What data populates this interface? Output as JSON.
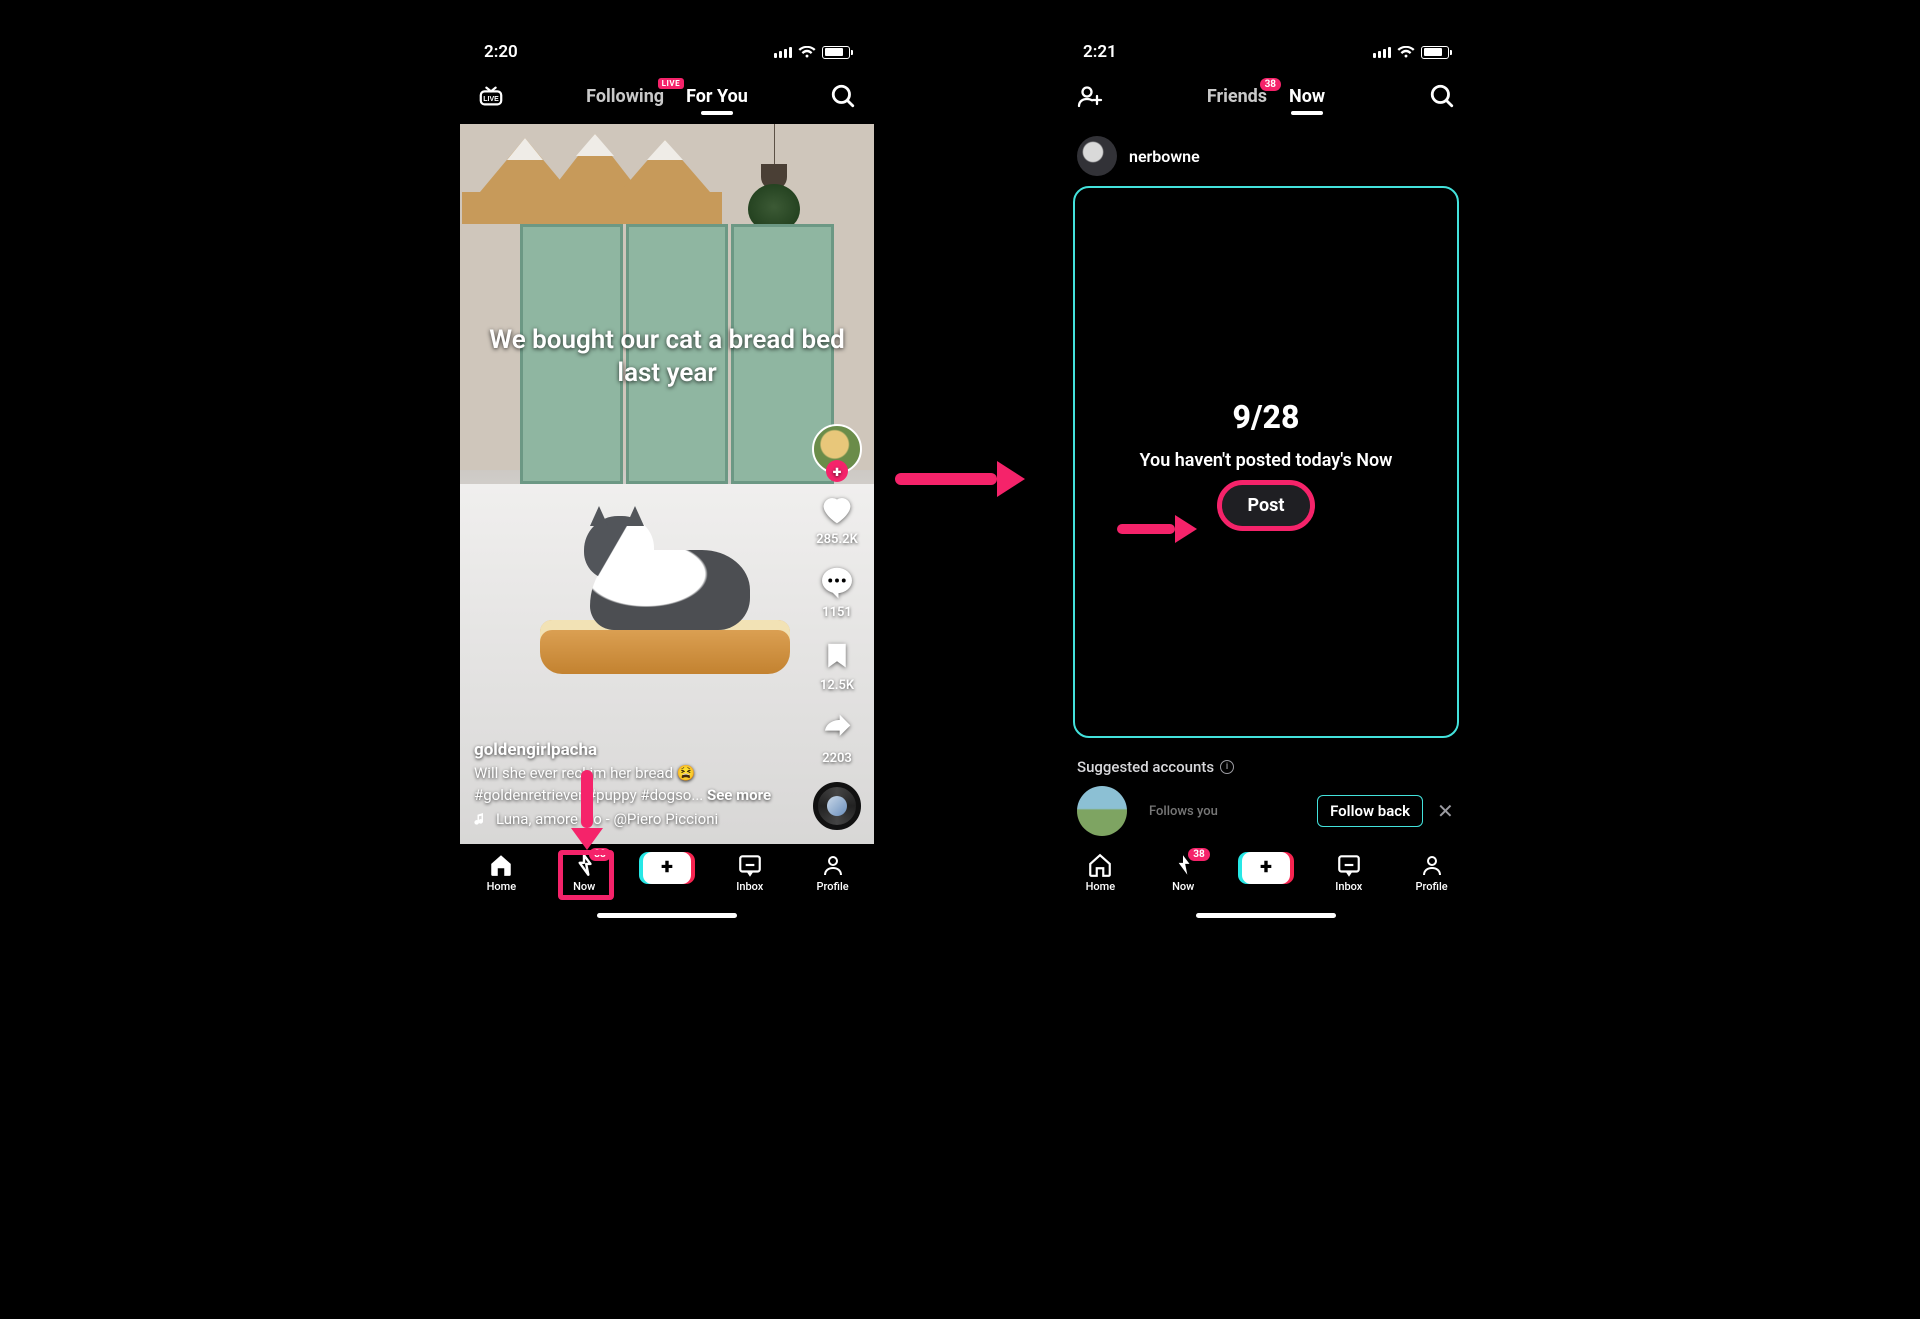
{
  "left": {
    "status_time": "2:20",
    "nav": {
      "following": "Following",
      "foryou": "For You",
      "live_badge": "LIVE"
    },
    "overlay_caption": "We bought our cat a bread bed last year",
    "side": {
      "like_count": "285.2K",
      "comment_count": "1151",
      "bookmark_count": "12.5K",
      "share_count": "2203"
    },
    "meta": {
      "username": "goldengirlpacha",
      "caption": "Will she ever recl   im her bread 😫",
      "hashtags": "#goldenretriever #puppy #dogso...",
      "see_more": "See more",
      "sound": "Luna, amore e  o - @Piero Piccioni"
    }
  },
  "right": {
    "status_time": "2:21",
    "nav": {
      "friends": "Friends",
      "friends_badge": "38",
      "now": "Now"
    },
    "user": "nerbowne",
    "now_date": "9/28",
    "now_message": "You haven't posted today's Now",
    "post_button": "Post",
    "suggested_header": "Suggested accounts",
    "sugg_sub": "Follows you",
    "follow_back": "Follow back"
  },
  "tabs": {
    "home": "Home",
    "now": "Now",
    "now_badge": "38",
    "inbox": "Inbox",
    "profile": "Profile"
  }
}
